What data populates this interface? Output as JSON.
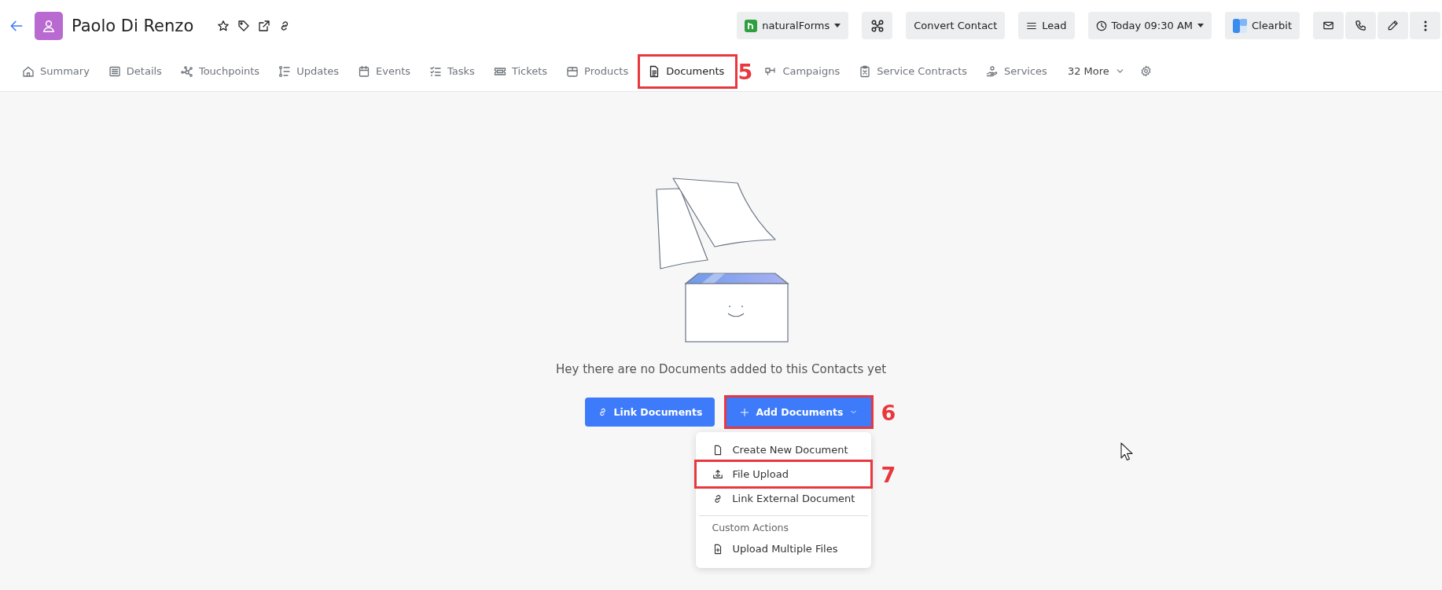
{
  "header": {
    "title": "Paolo Di Renzo",
    "actions": [
      {
        "kind": "dropdown",
        "label": "naturalForms"
      },
      {
        "kind": "icon"
      },
      {
        "kind": "text",
        "label": "Convert Contact"
      },
      {
        "kind": "text",
        "label": "Lead"
      },
      {
        "kind": "dropdown",
        "label": "Today 09:30 AM"
      },
      {
        "kind": "text",
        "label": "Clearbit"
      },
      {
        "kind": "icon"
      },
      {
        "kind": "icon"
      },
      {
        "kind": "icon"
      },
      {
        "kind": "icon"
      }
    ]
  },
  "tabs": [
    {
      "kind": "tab",
      "label": "Summary",
      "selected": false
    },
    {
      "kind": "tab",
      "label": "Details",
      "selected": false
    },
    {
      "kind": "tab",
      "label": "Touchpoints",
      "selected": false
    },
    {
      "kind": "tab",
      "label": "Updates",
      "selected": false
    },
    {
      "kind": "tab",
      "label": "Events",
      "selected": false
    },
    {
      "kind": "tab",
      "label": "Tasks",
      "selected": false
    },
    {
      "kind": "tab",
      "label": "Tickets",
      "selected": false
    },
    {
      "kind": "tab",
      "label": "Products",
      "selected": false
    },
    {
      "kind": "tab",
      "label": "Documents",
      "selected": true,
      "callout": "5"
    },
    {
      "kind": "tab",
      "label": "Campaigns",
      "selected": false
    },
    {
      "kind": "tab",
      "label": "Service Contracts",
      "selected": false
    },
    {
      "kind": "tab",
      "label": "Services",
      "selected": false
    },
    {
      "kind": "more",
      "label": "32 More",
      "selected": false
    }
  ],
  "empty_state": {
    "message": "Hey there are no Documents added to this Contacts yet",
    "buttons": [
      {
        "kind": "link",
        "label": "Link Documents"
      },
      {
        "kind": "add",
        "label": "Add Documents",
        "expanded": true,
        "callout": "6"
      }
    ],
    "menu": [
      {
        "kind": "item",
        "label": "Create New Document"
      },
      {
        "kind": "item",
        "label": "File Upload",
        "callout": "7"
      },
      {
        "kind": "item",
        "label": "Link External Document"
      },
      {
        "kind": "section",
        "label": "Custom Actions"
      },
      {
        "kind": "item",
        "label": "Upload Multiple Files"
      }
    ]
  }
}
